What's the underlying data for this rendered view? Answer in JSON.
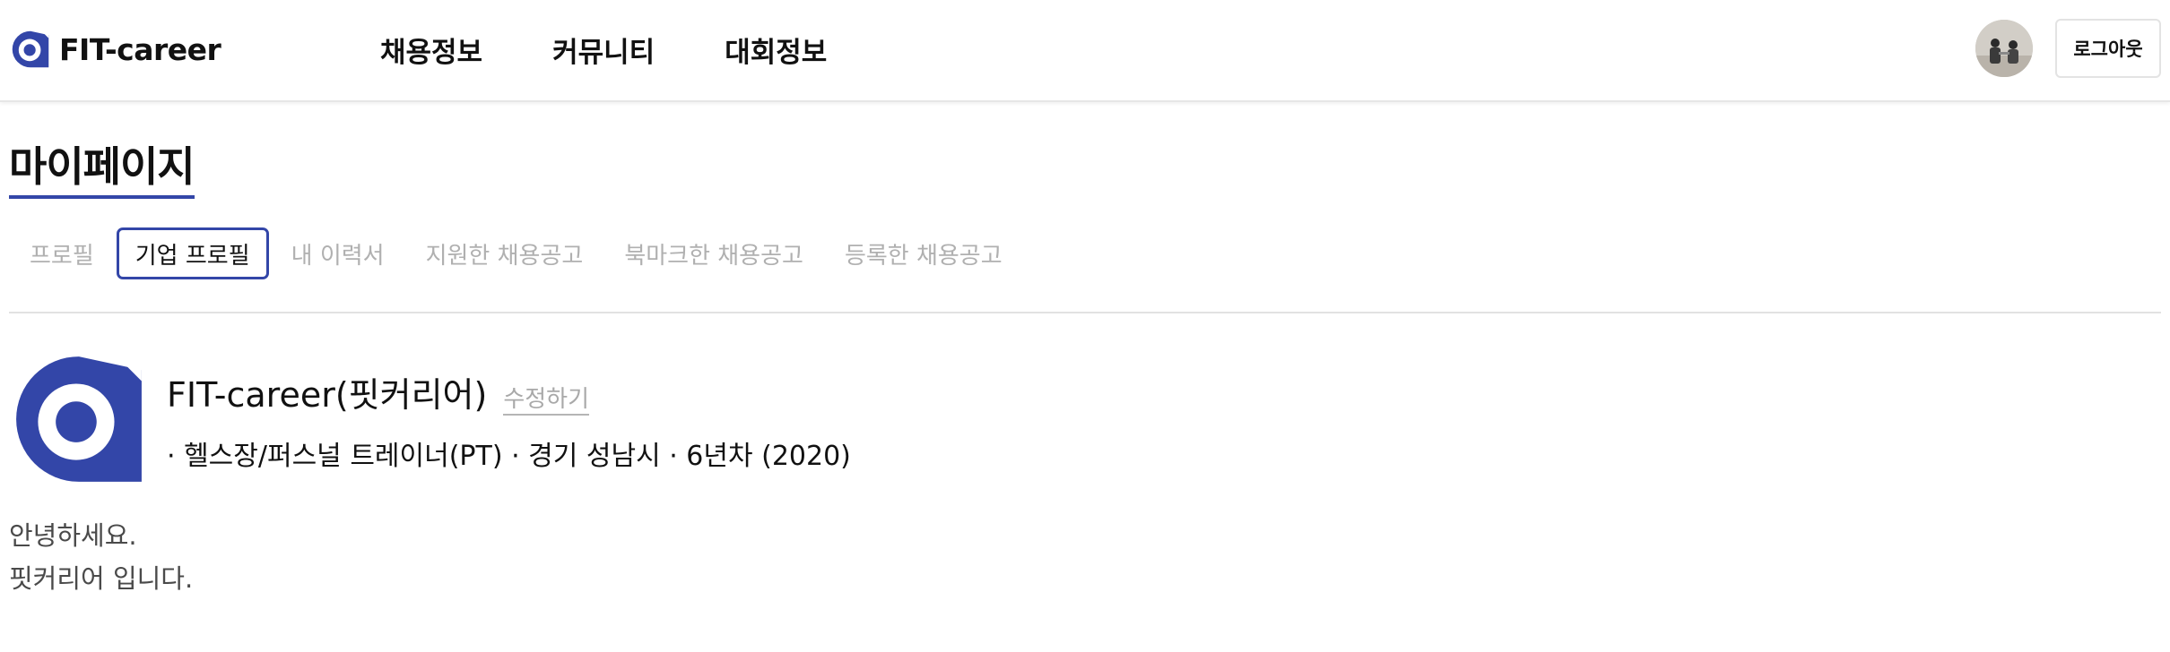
{
  "header": {
    "logo_text": "FIT-career",
    "nav": [
      {
        "label": "채용정보"
      },
      {
        "label": "커뮤니티"
      },
      {
        "label": "대회정보"
      }
    ],
    "logout_label": "로그아웃"
  },
  "page": {
    "title": "마이페이지"
  },
  "tabs": [
    {
      "label": "프로필",
      "active": false
    },
    {
      "label": "기업 프로필",
      "active": true
    },
    {
      "label": "내 이력서",
      "active": false
    },
    {
      "label": "지원한 채용공고",
      "active": false
    },
    {
      "label": "북마크한 채용공고",
      "active": false
    },
    {
      "label": "등록한 채용공고",
      "active": false
    }
  ],
  "company": {
    "name": "FIT-career(핏커리어)",
    "edit_label": "수정하기",
    "meta": "· 헬스장/퍼스널 트레이너(PT) · 경기 성남시 · 6년차 (2020)",
    "intro_lines": [
      "안녕하세요.",
      "핏커리어 입니다."
    ]
  },
  "colors": {
    "brand": "#3346a8",
    "muted_text": "#b0b0b0"
  },
  "icons": {
    "logo": "fitcareer-logo-icon",
    "avatar": "user-avatar"
  }
}
